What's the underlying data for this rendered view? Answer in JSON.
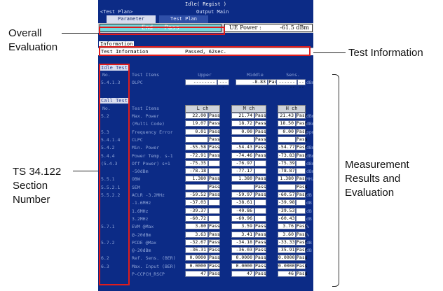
{
  "annotations": {
    "overall_evaluation": [
      "Overall",
      "Evaluation"
    ],
    "test_information": "Test Information",
    "ts_section": [
      "TS 34.122",
      "Section",
      "Number"
    ],
    "measurement": [
      "Measurement",
      "Results and",
      "Evaluation"
    ]
  },
  "header": {
    "status": "Idle( Regist )",
    "back": "<Test Plan>",
    "mode": "Output Main",
    "tabs": [
      "Parameter",
      "Test Plan"
    ]
  },
  "evaluation": {
    "overall": "End - Pass",
    "ue_power_label": "UE Power :",
    "ue_power_value": "-61.5 dBm"
  },
  "information": {
    "tag": "Information",
    "label": "Test Information",
    "value": "Passed, 62sec."
  },
  "idle_test": {
    "title": "Idle Test",
    "col_no": "No.",
    "col_items": "Test Items",
    "col_upper": "Upper",
    "col_middle": "Middle",
    "col_sens": "Sens.",
    "row": {
      "no": "5.4.1.3",
      "item": "OLPC",
      "upper": "--------",
      "upper_eval": "----",
      "middle": "-8.83",
      "middle_eval": "Pass",
      "sens": "--------",
      "sens_eval": "----",
      "unit": "dBm"
    }
  },
  "call_test": {
    "title": "Call Test",
    "col_no": "No.",
    "col_items": "Test Items",
    "channels": [
      "L ch",
      "M ch",
      "H ch"
    ],
    "rows": [
      {
        "no": "5.2",
        "item": "Max. Power",
        "v": [
          "22.00",
          "21.74",
          "21.43"
        ],
        "e": [
          "Pass",
          "Pass",
          "Pass"
        ],
        "unit": "dBm"
      },
      {
        "no": "",
        "item": "(Multi Code)",
        "v": [
          "19.07",
          "18.72",
          "18.50"
        ],
        "e": [
          "Pass",
          "Pass",
          "Pass"
        ],
        "unit": "dBm"
      },
      {
        "no": "5.3",
        "item": "Frequency Error",
        "v": [
          "0.01",
          "0.00",
          "0.00"
        ],
        "e": [
          "Pass",
          "Pass",
          "Pass"
        ],
        "unit": "ppm"
      },
      {
        "no": "5.4.1.4",
        "item": "CLPC",
        "v": [
          "",
          "",
          ""
        ],
        "e": [
          "Pass",
          "Pass",
          "Pass"
        ],
        "unit": ""
      },
      {
        "no": "5.4.2",
        "item": "Min. Power",
        "v": [
          "-55.58",
          "-54.43",
          "-54.77"
        ],
        "e": [
          "Pass",
          "Pass",
          "Pass"
        ],
        "unit": "dBm"
      },
      {
        "no": "5.4.4",
        "item": "Power Temp. s-1",
        "v": [
          "-72.91",
          "-74.46",
          "-73.83"
        ],
        "e": [
          "Pass",
          "Pass",
          "Pass"
        ],
        "unit": "dBm"
      },
      {
        "no": "(5.4.3",
        "item": "Off Power) s+1",
        "v": [
          "-75.35",
          "-76.97",
          "-75.39"
        ],
        "e": [
          "",
          "",
          ""
        ],
        "unit": "dBm"
      },
      {
        "no": "",
        "item": "-50dBm",
        "v": [
          "-78.18",
          "-77.17",
          "-78.87"
        ],
        "e": [
          "",
          "",
          ""
        ],
        "unit": "dBm"
      },
      {
        "no": "5.5.1",
        "item": "OBW",
        "v": [
          "1.380",
          "1.380",
          "1.380"
        ],
        "e": [
          "Pass",
          "Pass",
          "Pass"
        ],
        "unit": "MHz"
      },
      {
        "no": "5.5.2.1",
        "item": "SEM",
        "v": [
          "",
          "",
          ""
        ],
        "e": [
          "Pass",
          "Pass",
          "Pass"
        ],
        "unit": ""
      },
      {
        "no": "5.5.2.2",
        "item": "ACLR -3.2MHz",
        "v": [
          "-59.52",
          "-59.97",
          "-60.57"
        ],
        "e": [
          "Pass",
          "Pass",
          "Pass"
        ],
        "unit": "dB"
      },
      {
        "no": "",
        "item": "-1.6MHz",
        "v": [
          "-37.03",
          "-38.61",
          "-39.98"
        ],
        "e": [
          "",
          "",
          ""
        ],
        "unit": "dB"
      },
      {
        "no": "",
        "item": "1.6MHz",
        "v": [
          "-39.37",
          "-40.86",
          "-39.53"
        ],
        "e": [
          "",
          "",
          ""
        ],
        "unit": "dB"
      },
      {
        "no": "",
        "item": "3.2MHz",
        "v": [
          "-60.72",
          "-60.96",
          "-60.43"
        ],
        "e": [
          "",
          "",
          ""
        ],
        "unit": "dB"
      },
      {
        "no": "5.7.1",
        "item": "EVM @Max",
        "v": [
          "3.80",
          "3.59",
          "3.76"
        ],
        "e": [
          "Pass",
          "Pass",
          "Pass"
        ],
        "unit": "%"
      },
      {
        "no": "",
        "item": "@-20dBm",
        "v": [
          "3.63",
          "3.41",
          "3.60"
        ],
        "e": [
          "Pass",
          "Pass",
          "Pass"
        ],
        "unit": "%"
      },
      {
        "no": "5.7.2",
        "item": "PCDE @Max",
        "v": [
          "-32.67",
          "-34.18",
          "-33.33"
        ],
        "e": [
          "Pass",
          "Pass",
          "Pass"
        ],
        "unit": "dB"
      },
      {
        "no": "",
        "item": "@-20dBm",
        "v": [
          "-36.31",
          "-36.03",
          "-35.91"
        ],
        "e": [
          "Pass",
          "Pass",
          "Pass"
        ],
        "unit": "dB"
      },
      {
        "no": "6.2",
        "item": "Ref. Sens. (BER)",
        "v": [
          "0.0000",
          "0.0000",
          "0.0000"
        ],
        "e": [
          "Pass",
          "Pass",
          "Pass"
        ],
        "unit": ""
      },
      {
        "no": "6.3",
        "item": "Max. Input (BER)",
        "v": [
          "0.0000",
          "0.0000",
          "0.0000"
        ],
        "e": [
          "Pass",
          "Pass",
          "Pass"
        ],
        "unit": ""
      },
      {
        "no": "",
        "item": "P-CCPCH_RSCP",
        "v": [
          "47",
          "47",
          "46"
        ],
        "e": [
          "Pass",
          "Pass",
          "Pass"
        ],
        "unit": ""
      }
    ]
  }
}
